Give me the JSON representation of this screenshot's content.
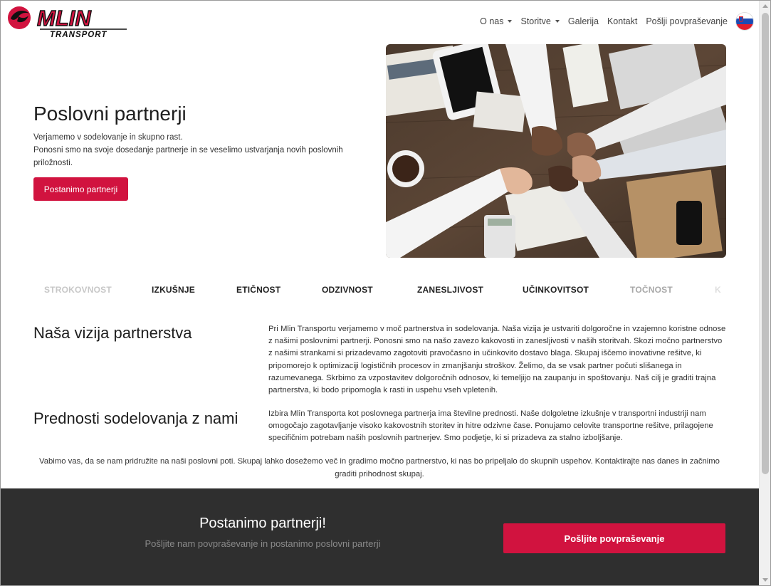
{
  "brand": {
    "logo_main": "MLIN",
    "logo_sub": "TRANSPORT",
    "primary_color": "#d1133f",
    "dark_color": "#2f2f2f"
  },
  "nav": {
    "items": [
      {
        "label": "O nas",
        "dropdown": true
      },
      {
        "label": "Storitve",
        "dropdown": true
      },
      {
        "label": "Galerija",
        "dropdown": false
      },
      {
        "label": "Kontakt",
        "dropdown": false
      },
      {
        "label": "Pošlji povpraševanje",
        "dropdown": false
      }
    ],
    "language_icon": "slovenia-flag-icon"
  },
  "hero": {
    "title": "Poslovni partnerji",
    "line1": "Verjamemo v sodelovanje in skupno rast.",
    "line2": "Ponosni smo na svoje dosedanje partnerje in se veselimo ustvarjanja novih poslovnih priložnosti.",
    "button_label": "Postanimo partnerji",
    "image_icon": "business-fist-bump-photo"
  },
  "values": [
    {
      "label": "STROKOVNOST",
      "faded": true
    },
    {
      "label": "IZKUŠNJE",
      "faded": false
    },
    {
      "label": "ETIČNOST",
      "faded": false
    },
    {
      "label": "ODZIVNOST",
      "faded": false
    },
    {
      "label": "ZANESLJIVOST",
      "faded": false
    },
    {
      "label": "UČINKOVITSOT",
      "faded": false
    },
    {
      "label": "TOČNOST",
      "faded": true
    },
    {
      "label": "K",
      "faded": true
    }
  ],
  "vision": {
    "title": "Naša vizija partnerstva",
    "text": "Pri Mlin Transportu verjamemo v moč partnerstva in sodelovanja. Naša vizija je ustvariti dolgoročne in vzajemno koristne odnose z našimi poslovnimi partnerji. Ponosni smo na našo zavezo kakovosti in zanesljivosti v naših storitvah. Skozi močno partnerstvo z našimi strankami si prizadevamo zagotoviti pravočasno in učinkovito dostavo blaga. Skupaj iščemo inovativne rešitve, ki pripomorejo k optimizaciji logističnih procesov in zmanjšanju stroškov. Želimo, da se vsak partner počuti slišanega in razumevanega. Skrbimo za vzpostavitev dolgoročnih odnosov, ki temeljijo na zaupanju in spoštovanju. Naš cilj je graditi trajna partnerstva, ki bodo pripomogla k rasti in uspehu vseh vpletenih."
  },
  "advantages": {
    "title": "Prednosti sodelovanja z nami",
    "text": "Izbira Mlin Transporta kot poslovnega partnerja ima številne prednosti. Naše dolgoletne izkušnje v transportni industriji nam omogočajo zagotavljanje visoko kakovostnih storitev in hitre odzivne čase. Ponujamo celovite transportne rešitve, prilagojene specifičnim potrebam naših poslovnih partnerjev. Smo podjetje, ki si prizadeva za stalno izboljšanje."
  },
  "closing": {
    "text": "Vabimo vas, da se nam pridružite na naši poslovni poti. Skupaj lahko dosežemo več in gradimo močno partnerstvo, ki nas bo pripeljalo do skupnih uspehov. Kontaktirajte nas danes in začnimo graditi prihodnost skupaj."
  },
  "cta": {
    "title": "Postanimo partnerji!",
    "subtitle": "Pošljite nam povpraševanje in postanimo poslovni parterji",
    "button_label": "Pošljite povpraševanje"
  }
}
